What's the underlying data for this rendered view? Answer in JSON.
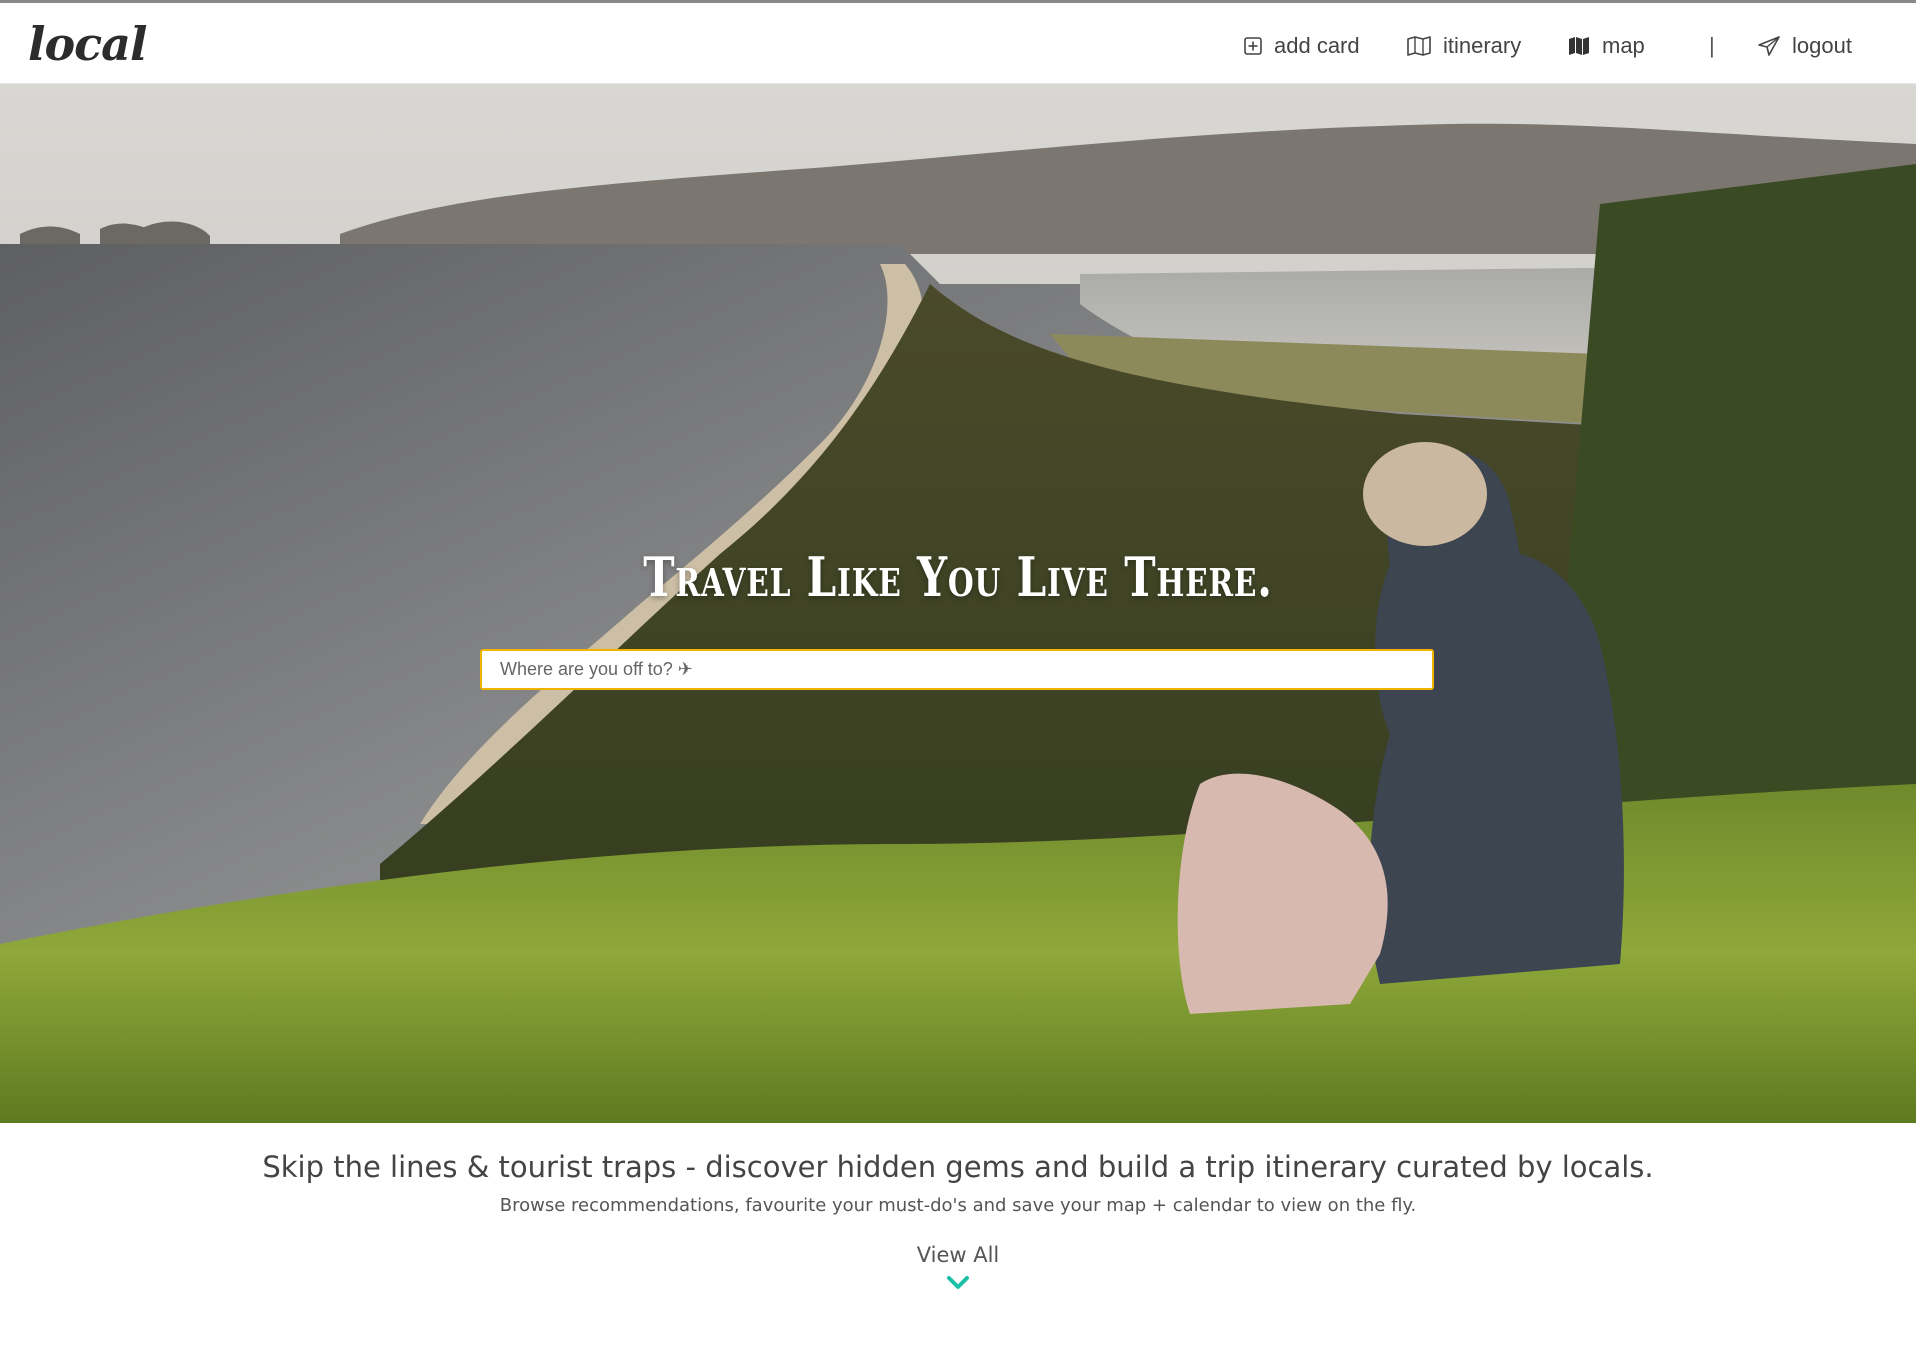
{
  "nav": {
    "logo": "local",
    "add_card": "add card",
    "itinerary": "itinerary",
    "map": "map",
    "separator": "|",
    "logout": "logout",
    "icons": [
      "plus-square-icon",
      "map-outline-icon",
      "map-filled-icon",
      "paper-plane-icon"
    ]
  },
  "hero": {
    "title": "Travel Like You Live There.",
    "search_placeholder": "Where are you off to? ✈",
    "search_value": ""
  },
  "intro": {
    "tagline": "Skip the lines & tourist traps - discover hidden gems and build a trip itinerary curated by locals.",
    "subline": "Browse recommendations, favourite your must-do's and save your map + calendar to view on the fly.",
    "view_all": "View All"
  },
  "colors": {
    "accent": "#1bbfa8",
    "search_border": "#f0b400",
    "text": "#444444"
  }
}
